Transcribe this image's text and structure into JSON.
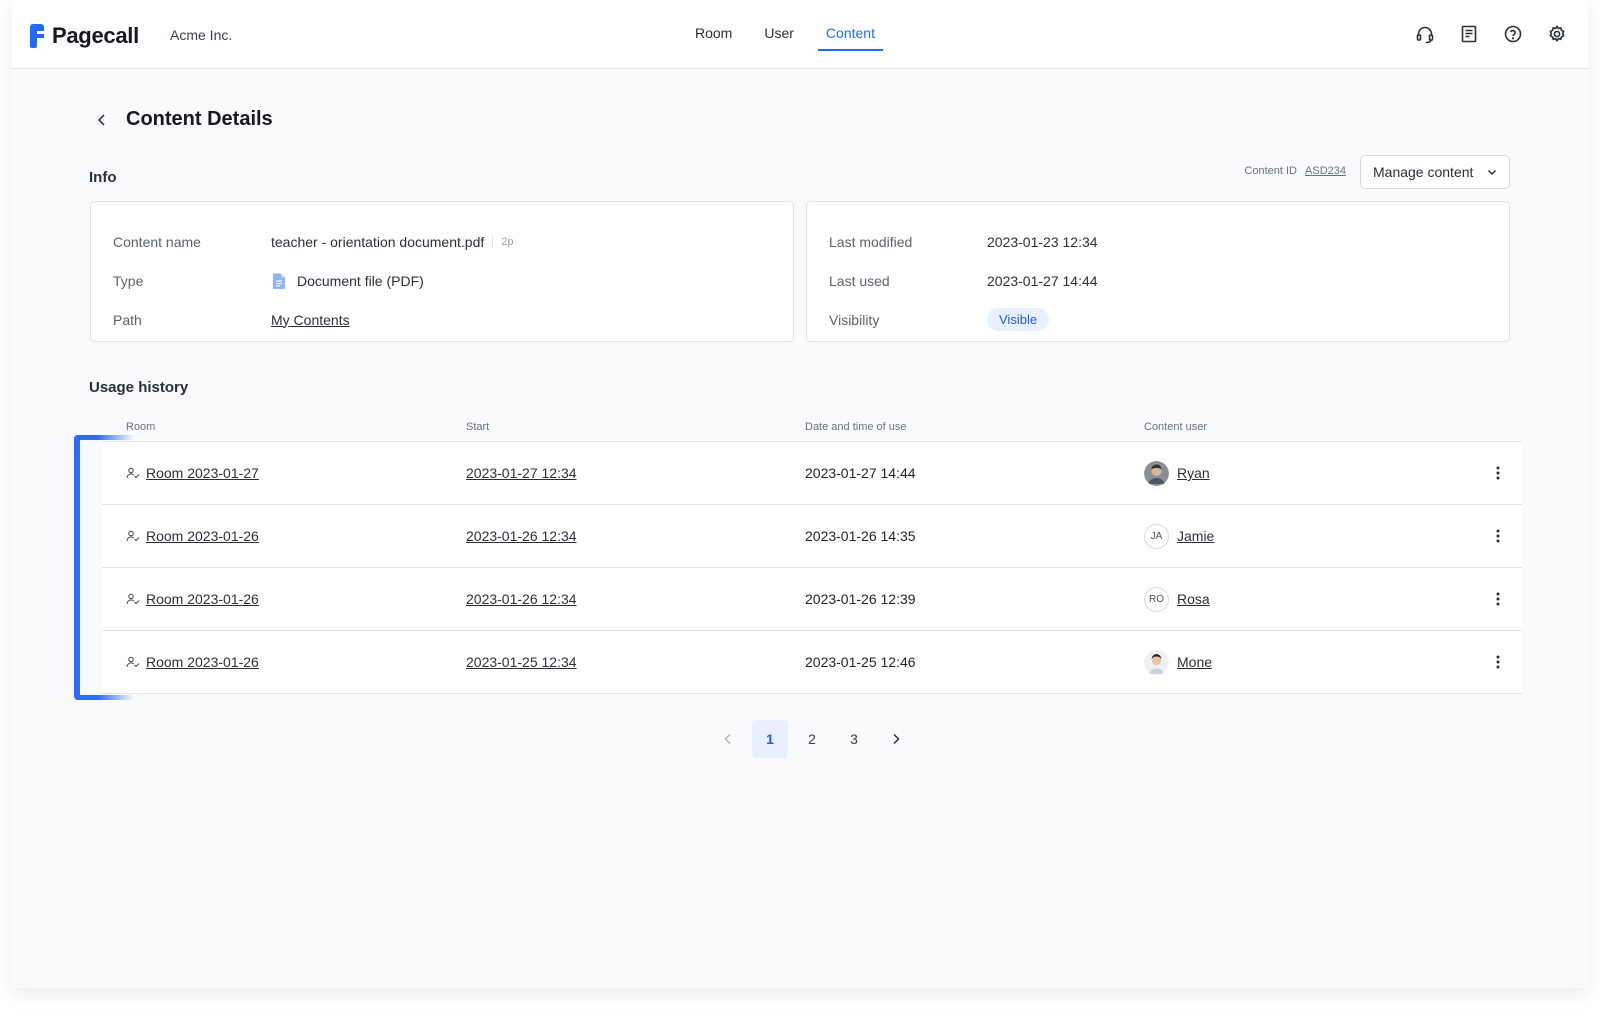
{
  "header": {
    "logo_text": "Pagecall",
    "org_name": "Acme Inc.",
    "nav": [
      {
        "label": "Room",
        "active": false
      },
      {
        "label": "User",
        "active": false
      },
      {
        "label": "Content",
        "active": true
      }
    ],
    "tools": [
      "headset-icon",
      "notes-icon",
      "help-icon",
      "settings-icon"
    ]
  },
  "page": {
    "title": "Content Details"
  },
  "info": {
    "section_title": "Info",
    "content_id_label": "Content ID",
    "content_id_value": "ASD234",
    "manage_label": "Manage content",
    "left": {
      "name_label": "Content name",
      "name_value": "teacher - orientation document.pdf",
      "page_count": "2p",
      "type_label": "Type",
      "type_value": "Document file (PDF)",
      "path_label": "Path",
      "path_value": "My Contents"
    },
    "right": {
      "modified_label": "Last modified",
      "modified_value": "2023-01-23 12:34",
      "used_label": "Last used",
      "used_value": "2023-01-27 14:44",
      "visibility_label": "Visibility",
      "visibility_value": "Visible"
    }
  },
  "usage": {
    "section_title": "Usage history",
    "columns": [
      "Room",
      "Start",
      "Date and time of use",
      "Content user"
    ],
    "rows": [
      {
        "room": "Room 2023-01-27",
        "start": "2023-01-27 12:34",
        "used": "2023-01-27 14:44",
        "user": "Ryan",
        "avatar": "photo",
        "initials": ""
      },
      {
        "room": "Room 2023-01-26",
        "start": "2023-01-26 12:34",
        "used": "2023-01-26 14:35",
        "user": "Jamie",
        "avatar": "initials",
        "initials": "JA"
      },
      {
        "room": "Room 2023-01-26",
        "start": "2023-01-26 12:34",
        "used": "2023-01-26 12:39",
        "user": "Rosa",
        "avatar": "initials",
        "initials": "RO"
      },
      {
        "room": "Room 2023-01-26",
        "start": "2023-01-25 12:34",
        "used": "2023-01-25 12:46",
        "user": "Mone",
        "avatar": "photo",
        "initials": ""
      }
    ]
  },
  "pagination": {
    "pages": [
      "1",
      "2",
      "3"
    ],
    "current": "1"
  },
  "colors": {
    "accent": "#1f6bff",
    "badge_bg": "#e8f0ff",
    "selection": "#2e6bff"
  }
}
